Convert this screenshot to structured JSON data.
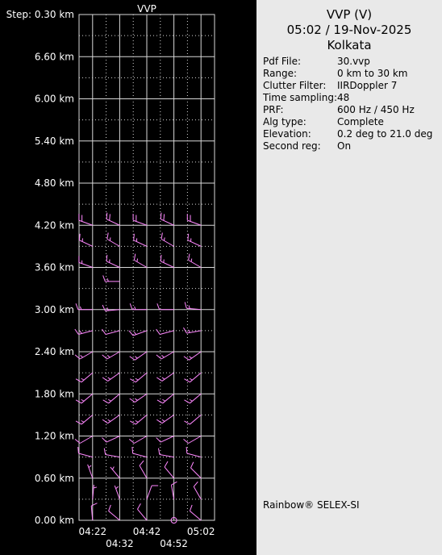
{
  "panel_title": "VVP",
  "header": {
    "line1": "VVP (V)",
    "line2": "05:02 / 19-Nov-2025",
    "line3": "Kolkata"
  },
  "info": [
    {
      "label": "Pdf File:",
      "value": "30.vvp"
    },
    {
      "label": "Range:",
      "value": "0 km to 30 km"
    },
    {
      "label": "Clutter Filter:",
      "value": "IIRDoppler 7"
    },
    {
      "label": "Time sampling:",
      "value": "48"
    },
    {
      "label": "PRF:",
      "value": "600 Hz / 450 Hz"
    },
    {
      "label": "Alg type:",
      "value": "Complete"
    },
    {
      "label": "Elevation:",
      "value": "0.2 deg to 21.0 deg"
    },
    {
      "label": "Second reg:",
      "value": "On"
    }
  ],
  "footer": "Rainbow® SELEX-SI",
  "chart_data": {
    "type": "scatter",
    "title": "VVP",
    "ylabel_prefix": "Step: 0.30 km",
    "y_tick_labels": [
      "0.00 km",
      "0.60 km",
      "1.20 km",
      "1.80 km",
      "2.40 km",
      "3.00 km",
      "3.60 km",
      "4.20 km",
      "4.80 km",
      "5.40 km",
      "6.00 km",
      "6.60 km"
    ],
    "y_ticks_km": [
      0.0,
      0.6,
      1.2,
      1.8,
      2.4,
      3.0,
      3.6,
      4.2,
      4.8,
      5.4,
      6.0,
      6.6
    ],
    "ylim_km": [
      0.0,
      7.2
    ],
    "x_tick_labels": [
      "04:22",
      "04:32",
      "04:42",
      "04:52",
      "05:02"
    ],
    "grid": true,
    "colors": {
      "barb": "#ff88ff",
      "calm": "#ff88ff",
      "grid": "#d8d8d8",
      "text": "#ffffff"
    },
    "barb_note": "wind barbs: direction in degrees (from), speed in knots",
    "levels": [
      {
        "height_km": 0.0,
        "barbs": [
          {
            "t": "04:22",
            "dir": 355,
            "spd": 10
          },
          {
            "t": "04:32",
            "dir": 310,
            "spd": 10
          },
          {
            "t": "04:42",
            "dir": 320,
            "spd": 10
          },
          {
            "t": "04:52",
            "calm": true
          },
          {
            "t": "05:02",
            "dir": 310,
            "spd": 10
          }
        ]
      },
      {
        "height_km": 0.3,
        "barbs": [
          {
            "t": "04:22",
            "dir": 5,
            "spd": 5
          },
          {
            "t": "04:32",
            "dir": 340,
            "spd": 5
          },
          {
            "t": "04:42",
            "dir": 20,
            "spd": 10
          },
          {
            "t": "04:52",
            "dir": 350,
            "spd": 10
          },
          {
            "t": "05:02",
            "dir": 330,
            "spd": 10
          }
        ]
      },
      {
        "height_km": 0.6,
        "barbs": [
          {
            "t": "04:22",
            "dir": 340,
            "spd": 5
          },
          {
            "t": "04:32",
            "dir": 320,
            "spd": 5
          },
          {
            "t": "04:42",
            "dir": 330,
            "spd": 10
          },
          {
            "t": "04:52",
            "dir": 320,
            "spd": 10
          },
          {
            "t": "05:02",
            "dir": 315,
            "spd": 10
          }
        ]
      },
      {
        "height_km": 0.9,
        "barbs": [
          {
            "t": "04:22",
            "dir": 285,
            "spd": 10
          },
          {
            "t": "04:32",
            "dir": 280,
            "spd": 10
          },
          {
            "t": "04:42",
            "dir": 285,
            "spd": 10
          },
          {
            "t": "04:52",
            "dir": 280,
            "spd": 10
          },
          {
            "t": "05:02",
            "dir": 285,
            "spd": 10
          }
        ]
      },
      {
        "height_km": 1.2,
        "barbs": [
          {
            "t": "04:22",
            "dir": 240,
            "spd": 10
          },
          {
            "t": "04:32",
            "dir": 245,
            "spd": 10
          },
          {
            "t": "04:42",
            "dir": 240,
            "spd": 10
          },
          {
            "t": "04:52",
            "dir": 245,
            "spd": 10
          },
          {
            "t": "05:02",
            "dir": 240,
            "spd": 10
          }
        ]
      },
      {
        "height_km": 1.5,
        "barbs": [
          {
            "t": "04:22",
            "dir": 230,
            "spd": 15
          },
          {
            "t": "04:32",
            "dir": 235,
            "spd": 15
          },
          {
            "t": "04:42",
            "dir": 230,
            "spd": 15
          },
          {
            "t": "04:52",
            "dir": 235,
            "spd": 15
          },
          {
            "t": "05:02",
            "dir": 230,
            "spd": 10
          }
        ]
      },
      {
        "height_km": 1.8,
        "barbs": [
          {
            "t": "04:22",
            "dir": 230,
            "spd": 15
          },
          {
            "t": "04:32",
            "dir": 230,
            "spd": 15
          },
          {
            "t": "04:42",
            "dir": 235,
            "spd": 15
          },
          {
            "t": "04:52",
            "dir": 230,
            "spd": 15
          },
          {
            "t": "05:02",
            "dir": 230,
            "spd": 15
          }
        ]
      },
      {
        "height_km": 2.1,
        "barbs": [
          {
            "t": "04:22",
            "dir": 230,
            "spd": 15
          },
          {
            "t": "04:32",
            "dir": 235,
            "spd": 15
          },
          {
            "t": "04:42",
            "dir": 230,
            "spd": 15
          },
          {
            "t": "04:52",
            "dir": 235,
            "spd": 15
          },
          {
            "t": "05:02",
            "dir": 230,
            "spd": 15
          }
        ]
      },
      {
        "height_km": 2.4,
        "barbs": [
          {
            "t": "04:22",
            "dir": 240,
            "spd": 15
          },
          {
            "t": "04:32",
            "dir": 240,
            "spd": 15
          },
          {
            "t": "04:42",
            "dir": 235,
            "spd": 15
          },
          {
            "t": "04:52",
            "dir": 240,
            "spd": 15
          },
          {
            "t": "05:02",
            "dir": 235,
            "spd": 15
          }
        ]
      },
      {
        "height_km": 2.7,
        "barbs": [
          {
            "t": "04:22",
            "dir": 255,
            "spd": 15
          },
          {
            "t": "04:32",
            "dir": 255,
            "spd": 10
          },
          {
            "t": "04:42",
            "dir": 250,
            "spd": 15
          },
          {
            "t": "04:52",
            "dir": 255,
            "spd": 10
          },
          {
            "t": "05:02",
            "dir": 260,
            "spd": 15
          }
        ]
      },
      {
        "height_km": 3.0,
        "barbs": [
          {
            "t": "04:22",
            "dir": 270,
            "spd": 15
          },
          {
            "t": "04:32",
            "dir": 265,
            "spd": 15
          },
          {
            "t": "04:42",
            "dir": 270,
            "spd": 15
          },
          {
            "t": "04:52",
            "dir": 270,
            "spd": 10
          },
          {
            "t": "05:02",
            "dir": 275,
            "spd": 15
          }
        ]
      },
      {
        "height_km": 3.4,
        "barbs": [
          {
            "t": "04:32",
            "dir": 270,
            "spd": 15
          }
        ]
      },
      {
        "height_km": 3.6,
        "barbs": [
          {
            "t": "04:22",
            "dir": 290,
            "spd": 15
          },
          {
            "t": "04:32",
            "dir": 295,
            "spd": 15
          },
          {
            "t": "04:42",
            "dir": 300,
            "spd": 15
          },
          {
            "t": "04:52",
            "dir": 295,
            "spd": 15
          },
          {
            "t": "05:02",
            "dir": 300,
            "spd": 15
          }
        ]
      },
      {
        "height_km": 3.9,
        "barbs": [
          {
            "t": "04:22",
            "dir": 295,
            "spd": 15
          },
          {
            "t": "04:32",
            "dir": 300,
            "spd": 15
          },
          {
            "t": "04:42",
            "dir": 295,
            "spd": 15
          },
          {
            "t": "04:52",
            "dir": 300,
            "spd": 15
          },
          {
            "t": "05:02",
            "dir": 295,
            "spd": 15
          }
        ]
      },
      {
        "height_km": 4.2,
        "barbs": [
          {
            "t": "04:22",
            "dir": 290,
            "spd": 20
          },
          {
            "t": "04:32",
            "dir": 295,
            "spd": 20
          },
          {
            "t": "04:42",
            "dir": 290,
            "spd": 20
          },
          {
            "t": "04:52",
            "dir": 295,
            "spd": 20
          },
          {
            "t": "05:02",
            "dir": 290,
            "spd": 20
          }
        ]
      }
    ]
  }
}
